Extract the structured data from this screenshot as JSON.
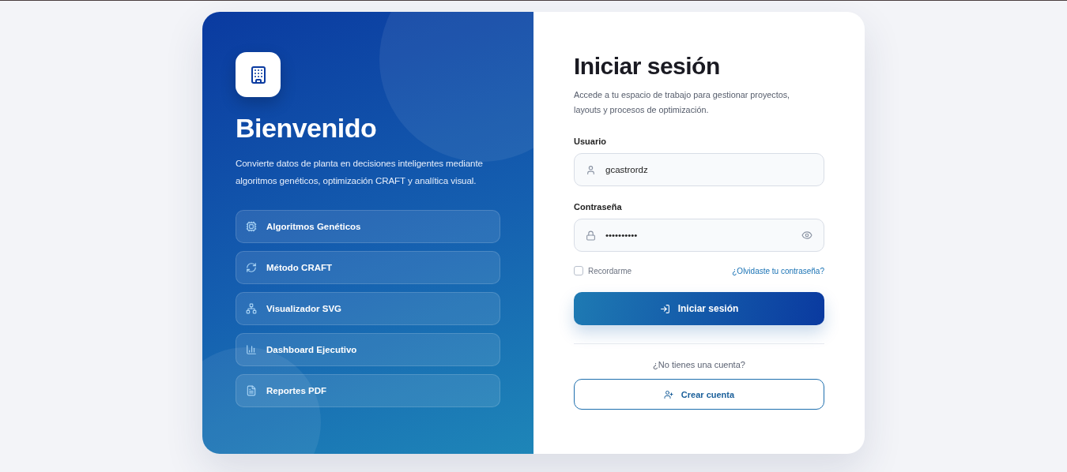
{
  "welcome": {
    "title": "Bienvenido",
    "description": "Convierte datos de planta en decisiones inteligentes mediante algoritmos genéticos, optimización CRAFT y analítica visual.",
    "features": [
      {
        "kind": "chip",
        "label": "Algoritmos Genéticos"
      },
      {
        "kind": "cycle",
        "label": "Método CRAFT"
      },
      {
        "kind": "network",
        "label": "Visualizador SVG"
      },
      {
        "kind": "chart",
        "label": "Dashboard Ejecutivo"
      },
      {
        "kind": "pdf",
        "label": "Reportes PDF"
      }
    ]
  },
  "login": {
    "title": "Iniciar sesión",
    "subtitle": "Accede a tu espacio de trabajo para gestionar proyectos, layouts y procesos de optimización.",
    "username": {
      "label": "Usuario",
      "value": "gcastrordz"
    },
    "password": {
      "label": "Contraseña",
      "value": "••••••••••"
    },
    "remember": {
      "label": "Recordarme",
      "checked": false
    },
    "forgot_link": "¿Olvidaste tu contraseña?",
    "submit": "Iniciar sesión",
    "signup_prompt": "¿No tienes una cuenta?",
    "signup_button": "Crear cuenta"
  }
}
